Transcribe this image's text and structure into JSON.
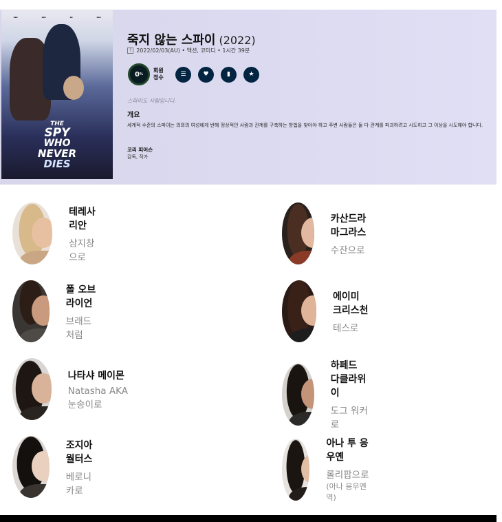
{
  "movie": {
    "title": "죽지 않는 스파이",
    "year": "(2022)",
    "rating_badge": "?",
    "meta": "2022/02/03(AU) • 액션, 코미디 • 1시간 39분",
    "score": "0",
    "score_unit": "%",
    "score_label": "회원 정수",
    "tagline": "스파이도 사람입니다.",
    "overview_heading": "개요",
    "overview": "세계적 수준의 스파이는 의외의 여성에게 반해 정상적인 사람과 관계를 구축하는 방법을 찾아야 하고 주변 사람들은 둘 다 관계를 파괴하려고 시도하고 그 이상을 시도해야 합니다.",
    "crew_name": "코리 피어슨",
    "crew_role": "감독, 작가",
    "poster": {
      "line1": "THE",
      "line2": "SPY",
      "line3": "WHO",
      "line4": "NEVER",
      "line5": "DIES"
    }
  },
  "actions": [
    {
      "icon": "list-icon",
      "glyph": "☰"
    },
    {
      "icon": "heart-icon",
      "glyph": "♥"
    },
    {
      "icon": "bookmark-icon",
      "glyph": "▮"
    },
    {
      "icon": "star-icon",
      "glyph": "★"
    }
  ],
  "cast": [
    {
      "name": "테레사 리안",
      "role": "삼지창으로",
      "role_extra": ""
    },
    {
      "name": "카산드라 마그라스",
      "role": "수잔으로",
      "role_extra": ""
    },
    {
      "name": "폴 오브라이언",
      "role": "브래드처럼",
      "role_extra": ""
    },
    {
      "name": "에이미 크리스천",
      "role": "테스로",
      "role_extra": ""
    },
    {
      "name": "나타샤 메이몬",
      "role": "Natasha AKA 눈송이로",
      "role_extra": ""
    },
    {
      "name": "하페드 다클라위이",
      "role": "도그 워커로",
      "role_extra": ""
    },
    {
      "name": "조지아 월터스",
      "role": "베로니카로",
      "role_extra": ""
    },
    {
      "name": "아나 투 응우옌",
      "role": "롤리팝으로",
      "role_extra": "(아나 응우옌 역)"
    }
  ]
}
